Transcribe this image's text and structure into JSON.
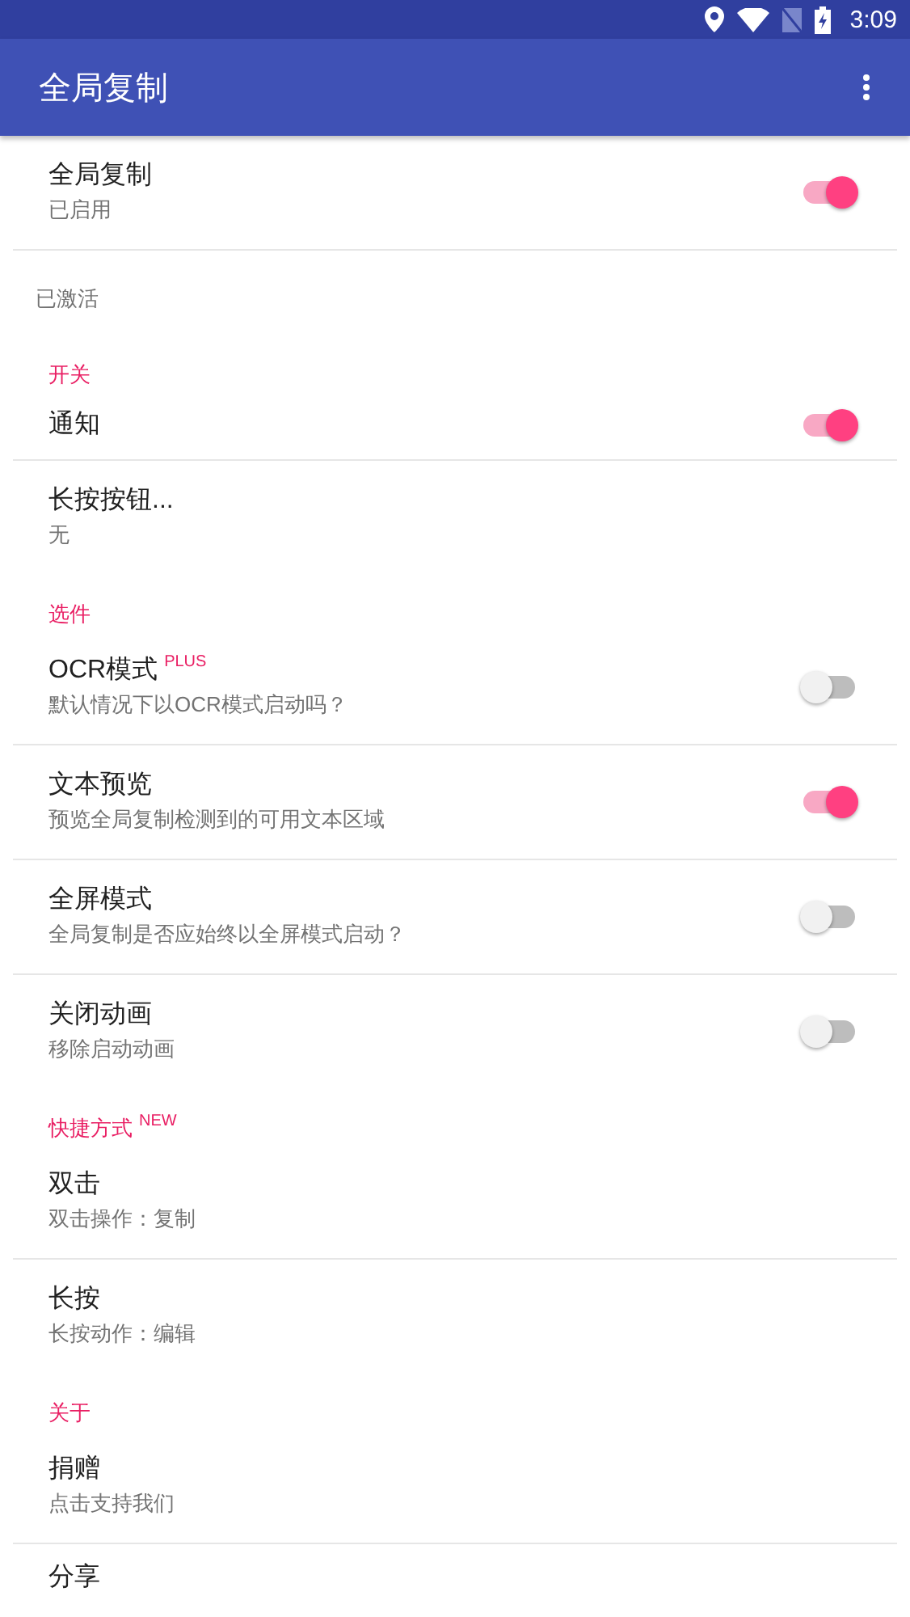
{
  "status_bar": {
    "time": "3:09"
  },
  "toolbar": {
    "title": "全局复制"
  },
  "master": {
    "title": "全局复制",
    "subtitle": "已启用",
    "checked": true
  },
  "status_note": "已激活",
  "sections": [
    {
      "header": "开关",
      "items": [
        {
          "kind": "switch",
          "title": "通知",
          "checked": true
        },
        {
          "kind": "plain",
          "title": "长按按钮...",
          "subtitle": "无"
        }
      ]
    },
    {
      "header": "选件",
      "items": [
        {
          "kind": "switch",
          "title": "OCR模式",
          "badge": "PLUS",
          "subtitle": "默认情况下以OCR模式启动吗？",
          "checked": false
        },
        {
          "kind": "switch",
          "title": "文本预览",
          "subtitle": "预览全局复制检测到的可用文本区域",
          "checked": true
        },
        {
          "kind": "switch",
          "title": "全屏模式",
          "subtitle": "全局复制是否应始终以全屏模式启动？",
          "checked": false
        },
        {
          "kind": "switch",
          "title": "关闭动画",
          "subtitle": "移除启动动画",
          "checked": false
        }
      ]
    },
    {
      "header": "快捷方式",
      "badge": "NEW",
      "items": [
        {
          "kind": "plain",
          "title": "双击",
          "subtitle": "双击操作：复制"
        },
        {
          "kind": "plain",
          "title": "长按",
          "subtitle": "长按动作：编辑"
        }
      ]
    },
    {
      "header": "关于",
      "items": [
        {
          "kind": "plain",
          "title": "捐赠",
          "subtitle": "点击支持我们"
        },
        {
          "kind": "plain",
          "title": "分享"
        }
      ]
    }
  ]
}
